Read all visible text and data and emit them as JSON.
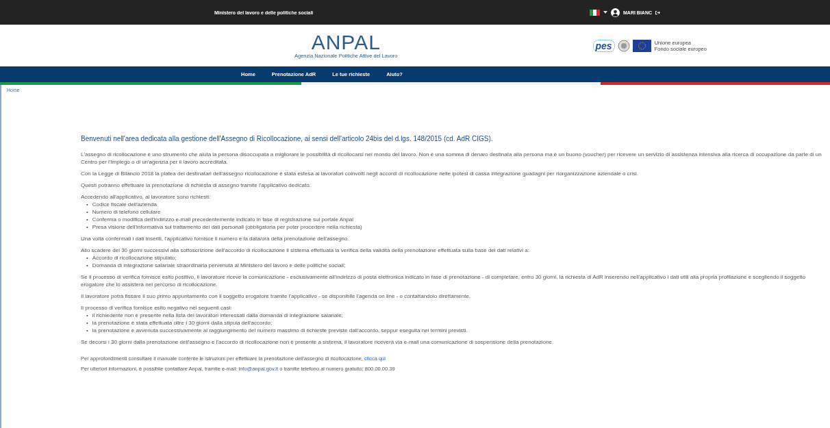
{
  "top_bar": {
    "title": "Ministero del lavoro e delle politiche sociali",
    "user": "MARI BIANC"
  },
  "header": {
    "logo": "ANPAL",
    "tagline": "Agenzia Nazionale Politiche Attive del Lavoro",
    "pes": "pes",
    "eu_lines": [
      "Unione europea",
      "Fondo sociale europeo"
    ]
  },
  "nav": [
    "Home",
    "Prenotazione AdR",
    "Le tue richieste",
    "Aiuto?"
  ],
  "breadcrumb": "Home",
  "title": "Benvenuti nell'area dedicata alla gestione dell'Assegno di Ricollocazione, ai sensi dell'articolo 24bis del d.lgs. 148/2015 (cd. AdR CIGS).",
  "blocks": [
    {
      "kind": "paragraph",
      "text": "L'assegno di ricollocazione è uno strumento che aiuta la persona disoccupata a migliorare le possibilità  di ricollocarsi nel mondo del lavoro. Non è una somma di denaro destinata alla persona ma è un buono (voucher) per ricevere un servizio di assistenza intensiva alla ricerca di occupazione da parte di un Centro per l'Impiego o di un'agenzia per il lavoro accreditata."
    },
    {
      "kind": "paragraph",
      "text": "Con la Legge di Bilancio 2018 la platea dei destinatari dell'assegno ricollocazione è stata estesa ai lavoratori coinvolti negli accordi di ricollocazione nelle ipotesi di cassa integrazione guadagni per riorganizzazione aziendale o crisi."
    },
    {
      "kind": "paragraph",
      "text": "Questi potranno effettuare la prenotazione di richiesta di assegno tramite l'applicativo dedicato."
    },
    {
      "kind": "list",
      "marker": "•",
      "intro": "Accedendo all'applicativo, al lavoratore sono richiesti:",
      "items": [
        "Codice fiscale dell'azienda",
        "Numero di telefono cellulare",
        "Conferma o modifica dell'indirizzo e-mail precedentemente indicato in fase di registrazione sul portale Anpal",
        "Presa visione dell'informativa sul trattamento dei dati personali (obbligatoria per poter procedere nella richiesta)"
      ]
    },
    {
      "kind": "paragraph",
      "text": "Una volta confermati i dati inseriti, l'applicativo fornisce il numero e la data/ora della prenotazione dell'assegno."
    },
    {
      "kind": "list",
      "marker": "•",
      "intro": "Allo scadere dei 30 giorni successivi alla sottoscrizione dell'accordo di ricollocazione il sistema effettuata la verifica della validità  della prenotazione effettuata sulla base dei dati relativi a:",
      "items": [
        "Accordo di ricollocazione stipulato;",
        "Domanda di integrazione salariale straordinaria pervenuta al Ministero del lavoro e delle politiche sociali;"
      ]
    },
    {
      "kind": "paragraph",
      "text": "Se il processo di verifica fornisce esito positivo, il lavoratore riceve la comunicazione - esclusivamente all'indirizzo di posta elettronica indicato in fase di prenotazione - di completare, entro 30 giorni, la richiesta di AdR inserendo nell'applicativo i dati utili alla propria profilazione e scegliendo il soggetto erogatore che lo assisterà  nel percorso di ricollocazione."
    },
    {
      "kind": "paragraph",
      "text": "Il lavoratore potrà fissare il suo primo appuntamento con il soggetto erogatore tramite l'applicativo - se disponibile l'agenda on line - o contattandolo direttamente."
    },
    {
      "kind": "list",
      "marker": "•",
      "intro": "Il processo di verifica fornisce esito negativo nei seguenti casi:",
      "items": [
        "il richiedente non è presente nella lista dei lavoratori interessati dalla domanda di integrazione salariale;",
        "la prenotazione è stata effettuata oltre i 30 giorni dalla stipula dell'accordo;",
        "la prenotazione è avvenuta successivamente al raggiungimento del numero massimo di richieste previste dall'accordo, seppur eseguita nei termini previsti."
      ]
    },
    {
      "kind": "paragraph",
      "text": "Se decorsi i 30 giorni dalla prenotazione dell'assegno e l'accordo di ricollocazione non è presente a sistema, il lavoratore riceverà  via e-mail una comunicazione di sospensione della prenotazione."
    }
  ],
  "notes": [
    {
      "before": "Per approfondimenti consultare il manuale contente le istruzioni per effettuare la prenotazione dell'assegno di ricollocazione, ",
      "link": "clicca qui"
    },
    {
      "before": "Per ulteriori informazioni, è possibile contattare Anpal, tramite e-mail: ",
      "link": "info@anpal.gov.it",
      "after": " o tramite telefono al numero gratuito: 800.00.00.39"
    }
  ]
}
